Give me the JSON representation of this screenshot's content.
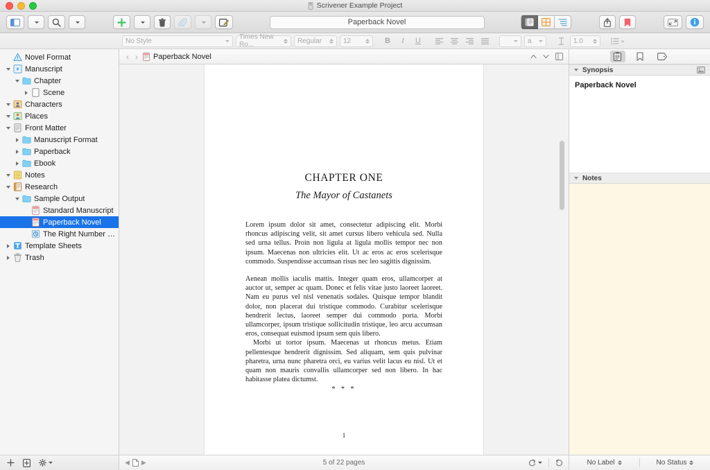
{
  "window": {
    "title": "Scrivener Example Project",
    "title_icon": "scrivener-app-icon"
  },
  "toolbar": {
    "view_toggle_label": "view-toggle",
    "search_label": "search",
    "add_label": "add",
    "trash_label": "trash",
    "attach_label": "attach",
    "compose_label": "compose",
    "title_field_value": "Paperback Novel",
    "group_document_label": "document-view",
    "group_corkboard_label": "corkboard-view",
    "group_outline_label": "outline-view",
    "share_label": "share",
    "bookmark_label": "bookmark",
    "fullscreen_label": "composition-mode",
    "info_label": "inspector"
  },
  "formatbar": {
    "style": "No Style",
    "font": "Times New Ro...",
    "weight": "Regular",
    "size": "12",
    "bold": "B",
    "italic": "I",
    "underline": "U",
    "line_height": "1.0"
  },
  "binder": {
    "items": [
      {
        "label": "Novel Format",
        "indent": 0,
        "disclosure": "none",
        "icon": "warning-icon",
        "selected": false
      },
      {
        "label": "Manuscript",
        "indent": 0,
        "disclosure": "open",
        "icon": "manuscript-icon",
        "selected": false
      },
      {
        "label": "Chapter",
        "indent": 1,
        "disclosure": "open",
        "icon": "folder-icon",
        "selected": false
      },
      {
        "label": "Scene",
        "indent": 2,
        "disclosure": "closed",
        "icon": "document-icon",
        "selected": false
      },
      {
        "label": "Characters",
        "indent": 0,
        "disclosure": "open",
        "icon": "characters-icon",
        "selected": false
      },
      {
        "label": "Places",
        "indent": 0,
        "disclosure": "open",
        "icon": "places-icon",
        "selected": false
      },
      {
        "label": "Front Matter",
        "indent": 0,
        "disclosure": "open",
        "icon": "frontmatter-icon",
        "selected": false
      },
      {
        "label": "Manuscript Format",
        "indent": 1,
        "disclosure": "closed",
        "icon": "folder-icon",
        "selected": false
      },
      {
        "label": "Paperback",
        "indent": 1,
        "disclosure": "closed",
        "icon": "folder-icon",
        "selected": false
      },
      {
        "label": "Ebook",
        "indent": 1,
        "disclosure": "closed",
        "icon": "folder-icon",
        "selected": false
      },
      {
        "label": "Notes",
        "indent": 0,
        "disclosure": "open",
        "icon": "notes-icon",
        "selected": false
      },
      {
        "label": "Research",
        "indent": 0,
        "disclosure": "open",
        "icon": "research-icon",
        "selected": false
      },
      {
        "label": "Sample Output",
        "indent": 1,
        "disclosure": "open",
        "icon": "folder-icon",
        "selected": false
      },
      {
        "label": "Standard Manuscript",
        "indent": 2,
        "disclosure": "none",
        "icon": "pdf-icon",
        "selected": false
      },
      {
        "label": "Paperback Novel",
        "indent": 2,
        "disclosure": "none",
        "icon": "pdf-icon",
        "selected": true
      },
      {
        "label": "The Right Number of Cups -",
        "indent": 2,
        "disclosure": "none",
        "icon": "media-icon",
        "selected": false
      },
      {
        "label": "Template Sheets",
        "indent": 0,
        "disclosure": "closed",
        "icon": "template-icon",
        "selected": false
      },
      {
        "label": "Trash",
        "indent": 0,
        "disclosure": "closed",
        "icon": "trash-icon",
        "selected": false
      }
    ],
    "footer": {
      "add_label": "add-item",
      "add_folder_label": "add-folder",
      "settings_label": "project-settings"
    },
    "selection_color": "#1a73e8"
  },
  "editor": {
    "breadcrumb": "Paperback Novel",
    "breadcrumb_icon": "pdf-icon",
    "back_label": "back",
    "forward_label": "forward",
    "header_up_label": "previous-document",
    "header_down_label": "next-document",
    "header_split_label": "split-editor",
    "document": {
      "heading": "CHAPTER ONE",
      "subheading": "The Mayor of Castanets",
      "paragraphs": [
        "Lorem ipsum dolor sit amet, consectetur adipiscing elit. Morbi rhoncus adipiscing velit, sit amet cursus libero vehicula sed. Nulla sed urna tellus. Proin non ligula at ligula mollis tempor nec non ipsum. Maecenas non ultricies elit. Ut ac eros ac eros scelerisque commodo. Suspendisse accumsan risus nec leo sagittis dignissim.",
        "Aenean mollis iaculis mattis. Integer quam eros, ullamcorper at auctor ut, semper ac quam. Donec et felis vitae justo laoreet laoreet. Nam eu purus vel nisl venenatis sodales. Quisque tempor blandit dolor, non placerat dui tristique commodo. Curabitur scelerisque hendrerit lectus, laoreet semper dui commodo porta. Morbi ullamcorper, ipsum tristique sollicitudin tristique, leo arcu accumsan eros, consequat euismod ipsum sem quis libero.",
        "Morbi ut tortor ipsum. Maecenas ut rhoncus metus. Etiam pellentesque hendrerit dignissim. Sed aliquam, sem quis pulvinar pharetra, urna nunc pharetra orci, eu varius velit lacus eu nisl. Ut et quam non mauris convallis ullamcorper sed non libero. In hac habitasse platea dictumst."
      ],
      "separator": "* * *",
      "page_number": "1"
    },
    "footer": {
      "prev_page_label": "previous-page",
      "page_icon_label": "page",
      "next_page_label": "next-page",
      "page_status": "5 of 22 pages",
      "reload_menu_label": "reload-options",
      "refresh_label": "refresh"
    }
  },
  "inspector": {
    "tabs": [
      {
        "label": "notes-tab",
        "icon": "clipboard-icon",
        "active": true
      },
      {
        "label": "bookmarks-tab",
        "icon": "bookmark-icon",
        "active": false
      },
      {
        "label": "keywords-tab",
        "icon": "tag-icon",
        "active": false
      }
    ],
    "synopsis": {
      "header": "Synopsis",
      "image_icon": "image-icon",
      "text": "Paperback Novel"
    },
    "notes": {
      "header": "Notes",
      "text": "",
      "background_color": "#fdf7e3"
    },
    "footer": {
      "label_value": "No Label",
      "status_value": "No Status"
    }
  }
}
